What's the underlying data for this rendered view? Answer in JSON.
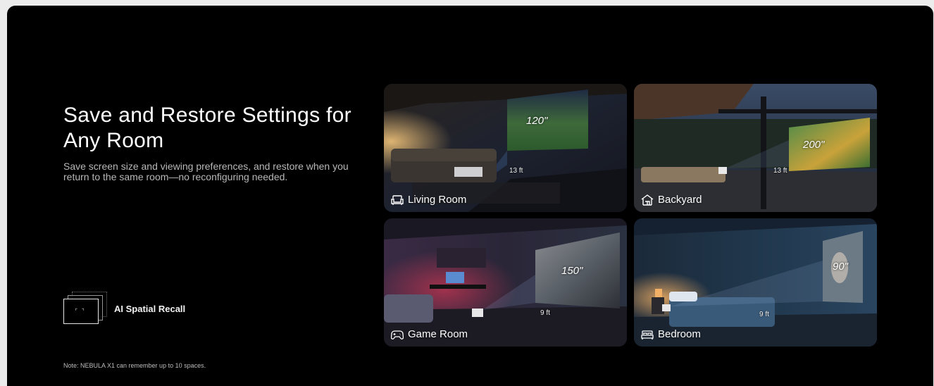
{
  "headline": "Save and Restore Settings for Any Room",
  "description": "Save screen size and viewing preferences, and restore when you return to the same room—no reconfiguring needed.",
  "feature": {
    "label": "AI Spatial Recall",
    "icon": "spatial-recall-icon"
  },
  "note": "Note: NEBULA X1 can remember up to 10 spaces.",
  "rooms": [
    {
      "name": "Living Room",
      "icon": "sofa-icon",
      "screen_size": "120\"",
      "distance": "13 ft"
    },
    {
      "name": "Backyard",
      "icon": "backyard-icon",
      "screen_size": "200\"",
      "distance": "13 ft"
    },
    {
      "name": "Game Room",
      "icon": "gamepad-icon",
      "screen_size": "150\"",
      "distance": "9 ft"
    },
    {
      "name": "Bedroom",
      "icon": "bed-icon",
      "screen_size": "90\"",
      "distance": "9 ft"
    }
  ],
  "colors": {
    "background": "#000000",
    "page": "#ececec",
    "text": "#ffffff",
    "muted": "#b8b8b8"
  }
}
